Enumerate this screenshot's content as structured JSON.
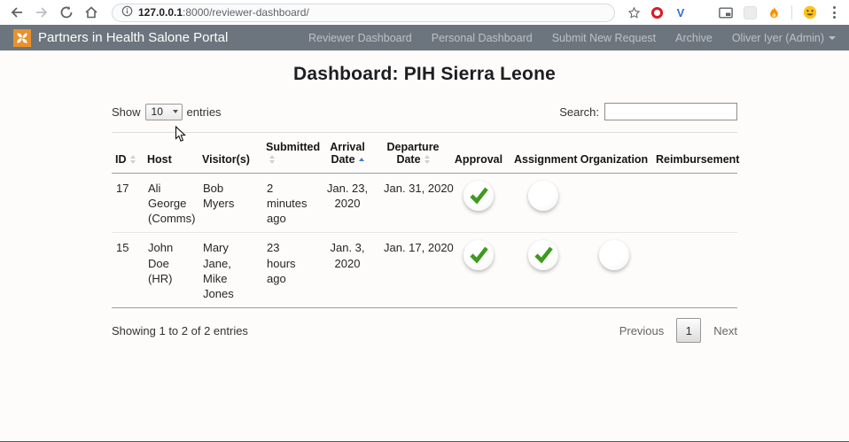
{
  "browser": {
    "url_host": "127.0.0.1",
    "url_rest": ":8000/reviewer-dashboard/",
    "toolbar_icons": [
      "back-arrow",
      "forward-arrow",
      "refresh",
      "home",
      "page-info",
      "bookmark-star"
    ],
    "extension_icons": [
      "red-ring-o",
      "vimium-v",
      "blue-grid",
      "picture-in-picture",
      "faded-square",
      "flame",
      "avatar-emoji",
      "overflow-menu"
    ],
    "vimium_letter": "V"
  },
  "navbar": {
    "brand": "Partners in Health Salone Portal",
    "items": [
      {
        "label": "Reviewer Dashboard"
      },
      {
        "label": "Personal Dashboard"
      },
      {
        "label": "Submit New Request"
      },
      {
        "label": "Archive"
      },
      {
        "label": "Oliver Iyer (Admin)"
      }
    ]
  },
  "page": {
    "title": "Dashboard: PIH Sierra Leone"
  },
  "controls": {
    "show_label": "Show",
    "page_size": "10",
    "entries_label": "entries",
    "search_label": "Search:",
    "search_value": ""
  },
  "table": {
    "columns": [
      {
        "label": "ID",
        "sort": "both"
      },
      {
        "label": "Host",
        "sort": "none"
      },
      {
        "label": "Visitor(s)",
        "sort": "none"
      },
      {
        "label": "Submitted",
        "sort": "both"
      },
      {
        "label": "Arrival Date",
        "sort": "asc"
      },
      {
        "label": "Departure Date",
        "sort": "both"
      },
      {
        "label": "Approval",
        "sort": "none"
      },
      {
        "label": "Assignment",
        "sort": "none"
      },
      {
        "label": "Organization",
        "sort": "none"
      },
      {
        "label": "Reimbursement",
        "sort": "none"
      }
    ],
    "rows": [
      {
        "id": "17",
        "host": "Ali George (Comms)",
        "visitors": "Bob Myers",
        "submitted": "2 minutes ago",
        "arrival": "Jan. 23, 2020",
        "departure": "Jan. 31, 2020",
        "approval": "check",
        "assignment": "empty",
        "organization": "none",
        "reimbursement": "none"
      },
      {
        "id": "15",
        "host": "John Doe (HR)",
        "visitors": "Mary Jane, Mike Jones",
        "submitted": "23 hours ago",
        "arrival": "Jan. 3, 2020",
        "departure": "Jan. 17, 2020",
        "approval": "check",
        "assignment": "check",
        "organization": "empty",
        "reimbursement": "none"
      }
    ]
  },
  "footer": {
    "info": "Showing 1 to 2 of 2 entries",
    "previous": "Previous",
    "page": "1",
    "next": "Next"
  },
  "colors": {
    "navbar_bg": "#6c757d",
    "logo_orange": "#e8912d",
    "check_green": "#3f9a1f",
    "sort_active": "#4379d9",
    "link_muted": "#bcc1c6"
  }
}
